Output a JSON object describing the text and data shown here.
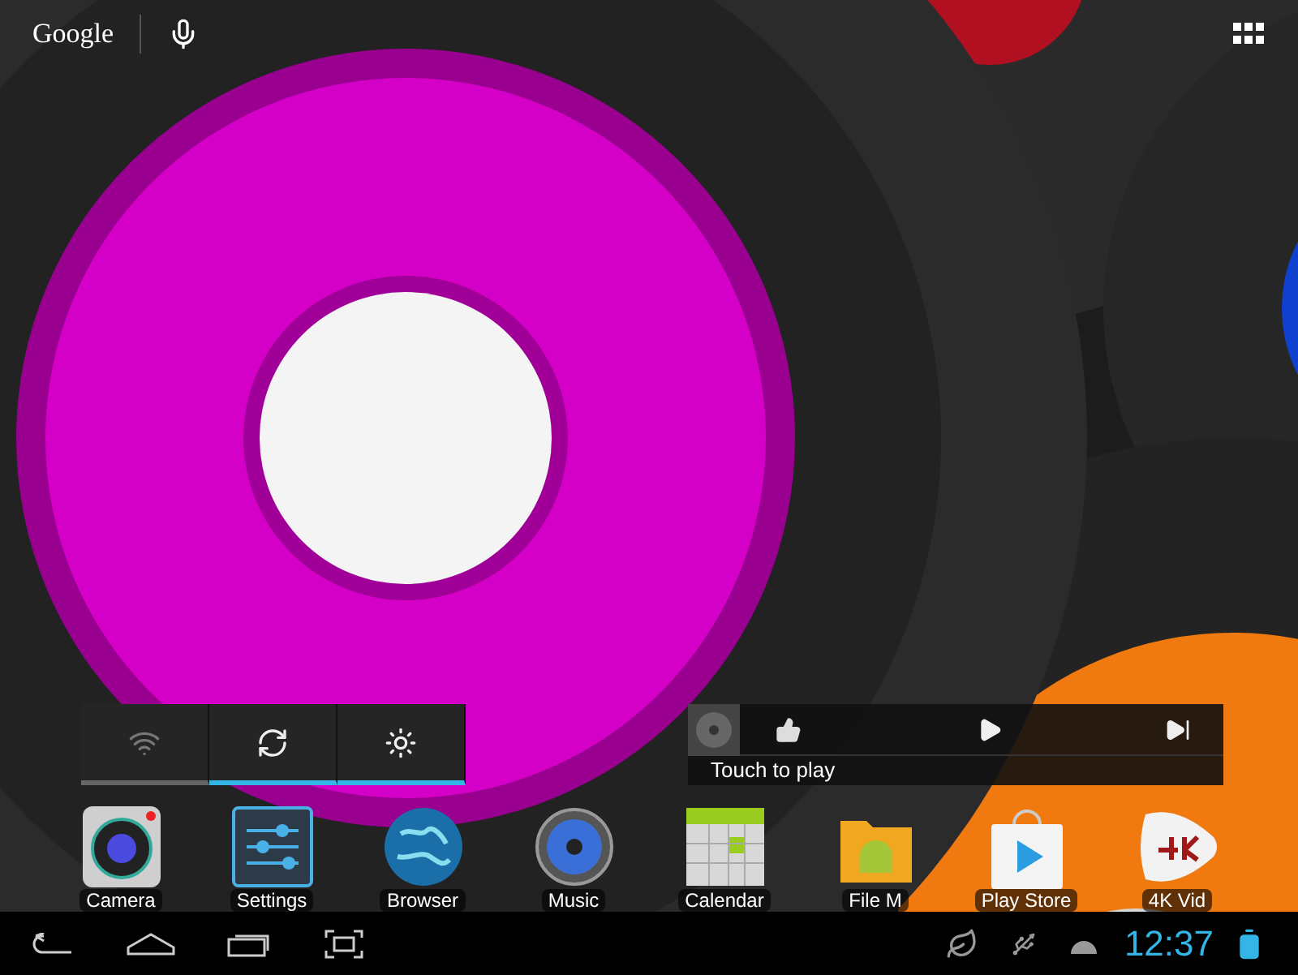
{
  "search_bar": {
    "logo": "Google"
  },
  "power_widget": {
    "toggles": [
      {
        "kind": "wifi",
        "on": false
      },
      {
        "kind": "sync",
        "on": true
      },
      {
        "kind": "brightness",
        "on": true
      }
    ]
  },
  "music_widget": {
    "status": "Touch to play"
  },
  "apps": [
    {
      "kind": "camera",
      "label": "Camera"
    },
    {
      "kind": "settings",
      "label": "Settings"
    },
    {
      "kind": "browser",
      "label": "Browser"
    },
    {
      "kind": "music",
      "label": "Music"
    },
    {
      "kind": "calendar",
      "label": "Calendar"
    },
    {
      "kind": "files",
      "label": "File M"
    },
    {
      "kind": "store",
      "label": "Play Store"
    },
    {
      "kind": "video",
      "label": "4K Vid"
    }
  ],
  "status_bar": {
    "time": "12:37"
  }
}
